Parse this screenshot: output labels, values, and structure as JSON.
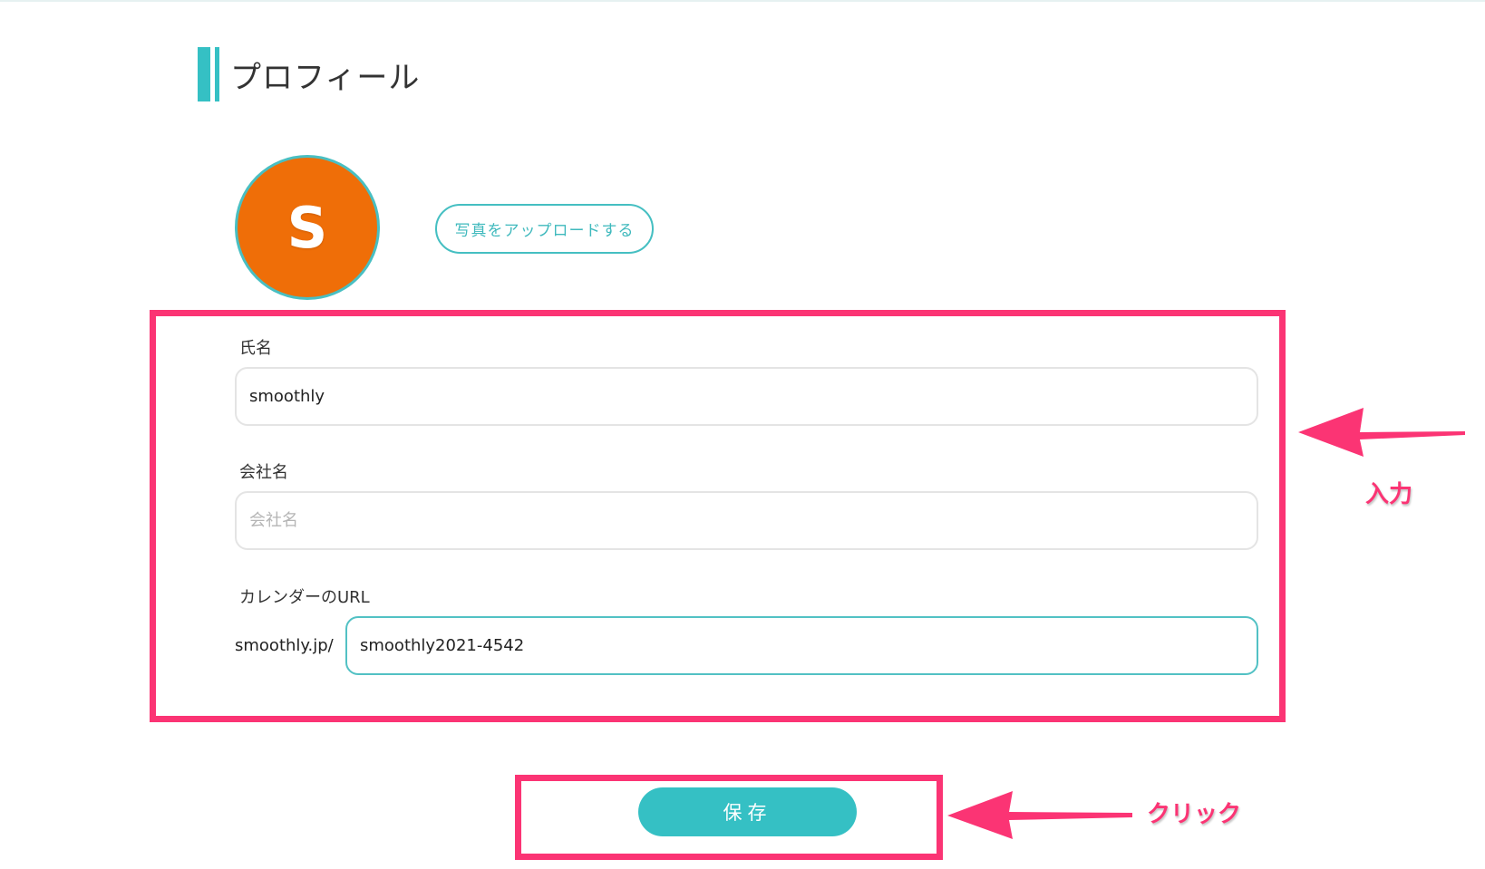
{
  "profile": {
    "title": "プロフィール",
    "avatar_initial": "S",
    "upload_label": "写真をアップロードする"
  },
  "form": {
    "name": {
      "label": "氏名",
      "value": "smoothly"
    },
    "company": {
      "label": "会社名",
      "value": "",
      "placeholder": "会社名"
    },
    "calendar_url": {
      "label": "カレンダーのURL",
      "prefix": "smoothly.jp/",
      "value": "smoothly2021-4542"
    }
  },
  "save_label": "保存",
  "annotations": {
    "input_label": "入力",
    "click_label": "クリック",
    "color": "#fb3474"
  },
  "colors": {
    "accent": "#35c0c4",
    "avatar_bg": "#ef6e08"
  }
}
